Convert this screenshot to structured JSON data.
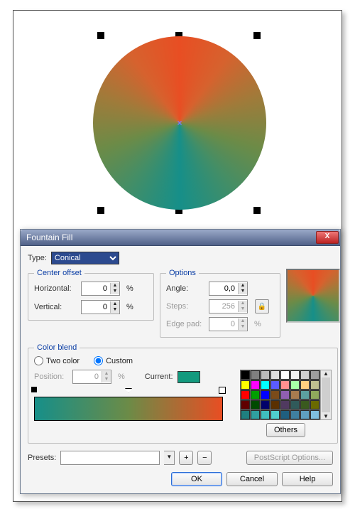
{
  "dialog": {
    "title": "Fountain Fill",
    "type_label": "Type:",
    "type_value": "Conical",
    "center_offset": {
      "legend": "Center offset",
      "horizontal_label": "Horizontal:",
      "horizontal_value": "0",
      "vertical_label": "Vertical:",
      "vertical_value": "0",
      "unit": "%"
    },
    "options": {
      "legend": "Options",
      "angle_label": "Angle:",
      "angle_value": "0,0",
      "steps_label": "Steps:",
      "steps_value": "256",
      "edgepad_label": "Edge pad:",
      "edgepad_value": "0",
      "unit": "%"
    },
    "color_blend": {
      "legend": "Color blend",
      "two_color_label": "Two color",
      "custom_label": "Custom",
      "position_label": "Position:",
      "position_value": "0",
      "position_unit": "%",
      "current_label": "Current:",
      "current_color": "#139a7e",
      "others_label": "Others"
    },
    "palette": [
      "#000000",
      "#7f7f7f",
      "#bbbbbb",
      "#dddddd",
      "#ffffff",
      "#f0f0f0",
      "#cfcfcf",
      "#9f9f9f",
      "#ffff00",
      "#ff00ff",
      "#00ffff",
      "#5b5bff",
      "#ff9090",
      "#a8ffa8",
      "#ffd080",
      "#bfbf90",
      "#ff0000",
      "#00a000",
      "#0000ff",
      "#7a4b1a",
      "#8f5fb0",
      "#a77b4f",
      "#5c9f9f",
      "#8fa85c",
      "#600000",
      "#004a00",
      "#00006a",
      "#5a3000",
      "#503a60",
      "#305a5a",
      "#3a5a1f",
      "#6a6a00",
      "#1f7f7f",
      "#2fa0a0",
      "#3fbfbf",
      "#4fcfcf",
      "#1f5f7f",
      "#3f7f9f",
      "#5f9fbf",
      "#7fbfdf"
    ],
    "presets": {
      "label": "Presets:",
      "value": "",
      "add": "+",
      "remove": "−",
      "postscript_label": "PostScript Options..."
    },
    "buttons": {
      "ok": "OK",
      "cancel": "Cancel",
      "help": "Help"
    }
  }
}
